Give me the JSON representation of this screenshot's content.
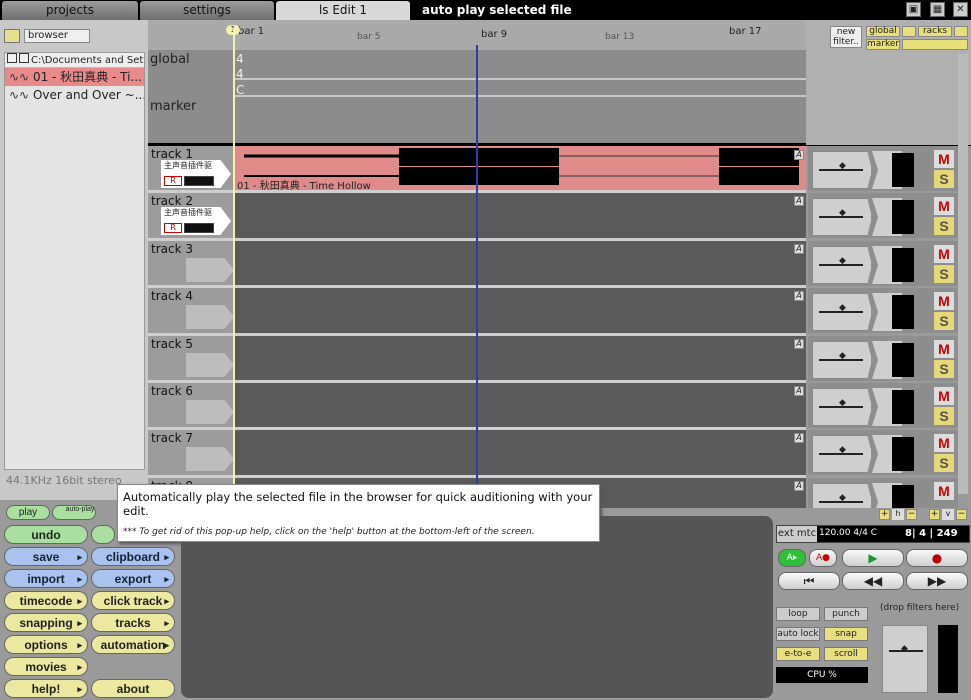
{
  "tabs": [
    {
      "label": "projects"
    },
    {
      "label": "settings"
    },
    {
      "label": "ls Edit 1"
    }
  ],
  "hint_title": "auto play selected file",
  "window_buttons": [
    "▣",
    "▦",
    "✕"
  ],
  "browser": {
    "mode": "browser",
    "path": "C:\\Documents and Setting...",
    "files": [
      "01 - 秋田真典 - Ti...",
      "Over and Over ~..."
    ],
    "audio_info": "44.1KHz 16bit stereo"
  },
  "ruler": {
    "bars": [
      "bar 1",
      "bar 5",
      "bar 9",
      "bar 13",
      "bar 17"
    ],
    "marker_icon": "1"
  },
  "global": {
    "label_global": "global",
    "label_marker": "marker",
    "sig_top": "4",
    "sig_bottom": "4",
    "key": "C"
  },
  "right_panel": {
    "new_filter": "new filter..",
    "global": "global",
    "racks": "racks",
    "marker": "marker"
  },
  "tracks": [
    {
      "name": "track 1",
      "has_clip": true,
      "badge": "主声音插件驱",
      "rec": "R",
      "clip_label": "01 - 秋田真典 - Time Hollow"
    },
    {
      "name": "track 2",
      "has_clip": false,
      "badge": "主声音插件驱",
      "rec": "R"
    },
    {
      "name": "track 3"
    },
    {
      "name": "track 4"
    },
    {
      "name": "track 5"
    },
    {
      "name": "track 6"
    },
    {
      "name": "track 7"
    },
    {
      "name": "track 8"
    }
  ],
  "track_buttons": {
    "a": "A",
    "m": "M",
    "s": "S"
  },
  "zoom": {
    "h": "h",
    "v": "v",
    "plus": "+",
    "minus": "−"
  },
  "left_buttons": {
    "play": "play",
    "auto_play": "auto-play",
    "undo": "undo",
    "save": "save",
    "clipboard": "clipboard",
    "import": "import",
    "export": "export",
    "timecode": "timecode",
    "click_track": "click track",
    "snapping": "snapping",
    "tracks": "tracks",
    "options": "options",
    "automation": "automation",
    "movies": "movies",
    "help": "help!",
    "about": "about"
  },
  "tooltip": {
    "main": "Automatically play the selected file in the browser for quick auditioning with your edit.",
    "note": "*** To get rid of this pop-up help, click on the 'help' button at the bottom-left of the screen."
  },
  "transport": {
    "ext_mtc": "ext mtc",
    "tempo": "120.00 4/4  C",
    "position": "8|  4  | 249",
    "loop": "loop",
    "punch": "punch",
    "auto_lock": "auto lock",
    "snap": "snap",
    "e_to_e": "e-to-e",
    "scroll": "scroll",
    "cpu": "CPU %",
    "drop_filters": "(drop filters here)"
  },
  "colors": {
    "clip": "#e88a8a",
    "playhead": "#2a3fa6",
    "accent_yellow": "#e8de7a"
  }
}
